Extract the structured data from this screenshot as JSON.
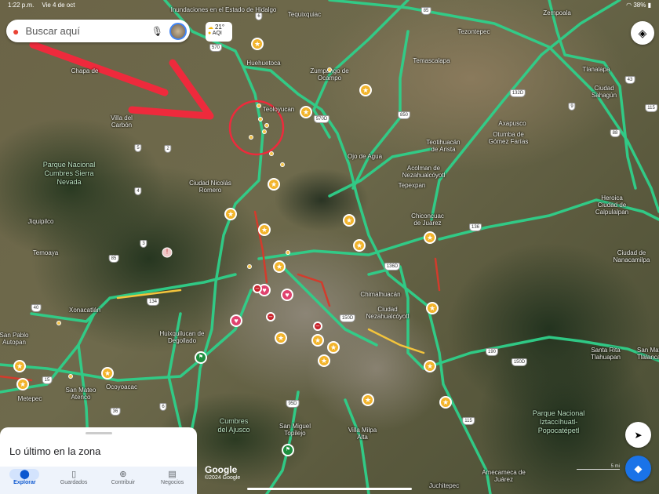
{
  "status_bar": {
    "time": "1:22 p.m.",
    "date": "Vie 4 de oct",
    "battery": "38%"
  },
  "search": {
    "placeholder": "Buscar aquí"
  },
  "weather": {
    "temperature": "21°",
    "aqi_label": "AQI"
  },
  "news_label": "Inundaciones en el Estado de Hidalgo",
  "places": [
    "Tequixquiac",
    "Zempoala",
    "Tezontepec",
    "Huehuetoca",
    "Zumpango de Ocampo",
    "Temascalapa",
    "Tlanalapa",
    "Ciudad Sahagún",
    "Chapa de",
    "Villa del Carbón",
    "Teoloyucan",
    "Axapusco",
    "Otumba de Gómez Farías",
    "Teotihuacán de Arista",
    "Ojo de Agua",
    "Acolman de Nezahualcóyotl",
    "Tepexpan",
    "Ciudad Nicolás Romero",
    "Heroica Ciudad de Calpulalpan",
    "Chiconcuac de Juárez",
    "Jiquipilco",
    "Temoaya",
    "Ciudad de Nanacamilpa",
    "Chimalhuacán",
    "Ciudad Nezahualcóyotl",
    "Xonacatlán",
    "Huixquilucan de Degollado",
    "San Pablo Autopan",
    "Santa Rita Tlahuapan",
    "San Mateo Atenco",
    "Ocoyoacac",
    "Metepec",
    "Villa Milpa Alta",
    "Cumbres del Ajusco",
    "San Miguel Topilejo",
    "Amecameca de Juárez",
    "San Matías Tlalancaleca",
    "Juchitepec"
  ],
  "parks": [
    "Parque Nacional Cumbres Sierra Nevada",
    "Parque Nacional Iztaccíhuatl-Popocatépetl"
  ],
  "shields": [
    "570",
    "6",
    "85",
    "132D",
    "9",
    "43",
    "115",
    "88",
    "850",
    "570D",
    "4",
    "5",
    "3",
    "2",
    "85",
    "134",
    "136",
    "136D",
    "40",
    "15",
    "36",
    "6",
    "95D",
    "150D",
    "190",
    "150D",
    "115"
  ],
  "bottom_sheet": {
    "title": "Lo último en la zona"
  },
  "nav": [
    {
      "label": "Explorar",
      "icon": "pin-icon"
    },
    {
      "label": "Guardados",
      "icon": "bookmark-icon"
    },
    {
      "label": "Contribuir",
      "icon": "add-circle-icon"
    },
    {
      "label": "Negocios",
      "icon": "store-icon"
    }
  ],
  "attribution": {
    "logo": "Google",
    "copyright": "©2024 Google"
  },
  "scale": "5 mi",
  "colors": {
    "traffic_green": "#2fd08a",
    "traffic_red": "#d33b2c",
    "traffic_yellow": "#f3c43c",
    "annotation_red": "#ee2a3c",
    "nav_accent": "#0b57d0"
  }
}
